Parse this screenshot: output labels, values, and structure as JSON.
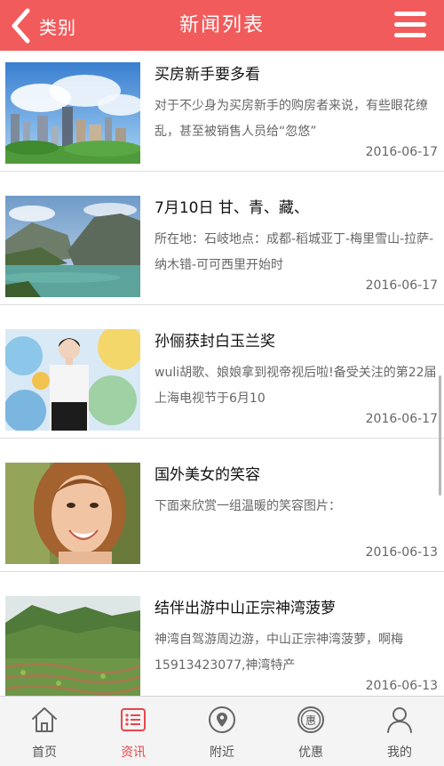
{
  "header": {
    "back_label": "类别",
    "title": "新闻列表"
  },
  "news": [
    {
      "title": "买房新手要多看",
      "summary": "对于不少身为买房新手的购房者来说，有些眼花缭乱，甚至被销售人员给“忽悠”",
      "date": "2016-06-17",
      "thumb": "city-skyline"
    },
    {
      "title": "7月10日 甘、青、藏、",
      "summary": "所在地：石岐地点：成都-稻城亚丁-梅里雪山-拉萨-纳木错-可可西里开始时",
      "date": "2016-06-17",
      "thumb": "river-gorge"
    },
    {
      "title": "孙俪获封白玉兰奖",
      "summary": "wuli胡歌、娘娘拿到视帝视后啦!备受关注的第22届上海电视节于6月10",
      "date": "2016-06-17",
      "thumb": "award-woman"
    },
    {
      "title": "国外美女的笑容",
      "summary": "下面来欣赏一组温暖的笑容图片：",
      "date": "2016-06-13",
      "thumb": "smiling-woman"
    },
    {
      "title": "结伴出游中山正宗神湾菠萝",
      "summary": "神湾自驾游周边游，中山正宗神湾菠萝，啊梅15913423077,神湾特产",
      "date": "2016-06-13",
      "thumb": "pineapple-hills"
    }
  ],
  "tabs": [
    {
      "label": "首页",
      "icon": "home-icon",
      "active": false
    },
    {
      "label": "资讯",
      "icon": "news-icon",
      "active": true
    },
    {
      "label": "附近",
      "icon": "location-icon",
      "active": false
    },
    {
      "label": "优惠",
      "icon": "discount-icon",
      "active": false
    },
    {
      "label": "我的",
      "icon": "user-icon",
      "active": false
    }
  ],
  "colors": {
    "header_bg": "#f25b5c",
    "active_tab": "#e8474c",
    "inactive_tab": "#555555"
  }
}
